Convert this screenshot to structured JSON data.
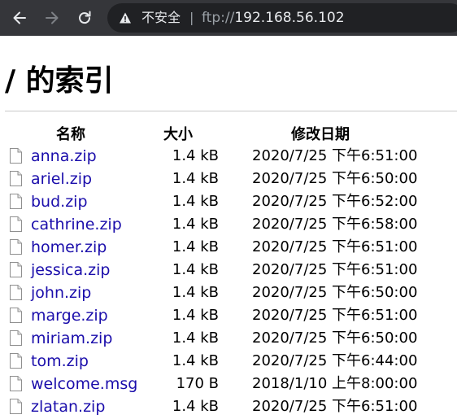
{
  "browser": {
    "security_label": "不安全",
    "separator": "|",
    "url_scheme": "ftp://",
    "url_host": "192.168.56.102"
  },
  "page": {
    "title": "/ 的索引",
    "columns": {
      "name": "名称",
      "size": "大小",
      "modified": "修改日期"
    },
    "files": [
      {
        "name": "anna.zip",
        "size": "1.4 kB",
        "modified": "2020/7/25 下午6:51:00"
      },
      {
        "name": "ariel.zip",
        "size": "1.4 kB",
        "modified": "2020/7/25 下午6:50:00"
      },
      {
        "name": "bud.zip",
        "size": "1.4 kB",
        "modified": "2020/7/25 下午6:52:00"
      },
      {
        "name": "cathrine.zip",
        "size": "1.4 kB",
        "modified": "2020/7/25 下午6:58:00"
      },
      {
        "name": "homer.zip",
        "size": "1.4 kB",
        "modified": "2020/7/25 下午6:51:00"
      },
      {
        "name": "jessica.zip",
        "size": "1.4 kB",
        "modified": "2020/7/25 下午6:51:00"
      },
      {
        "name": "john.zip",
        "size": "1.4 kB",
        "modified": "2020/7/25 下午6:50:00"
      },
      {
        "name": "marge.zip",
        "size": "1.4 kB",
        "modified": "2020/7/25 下午6:51:00"
      },
      {
        "name": "miriam.zip",
        "size": "1.4 kB",
        "modified": "2020/7/25 下午6:50:00"
      },
      {
        "name": "tom.zip",
        "size": "1.4 kB",
        "modified": "2020/7/25 下午6:44:00"
      },
      {
        "name": "welcome.msg",
        "size": "170 B",
        "modified": "2018/1/10 上午8:00:00"
      },
      {
        "name": "zlatan.zip",
        "size": "1.4 kB",
        "modified": "2020/7/25 下午6:51:00"
      }
    ]
  }
}
